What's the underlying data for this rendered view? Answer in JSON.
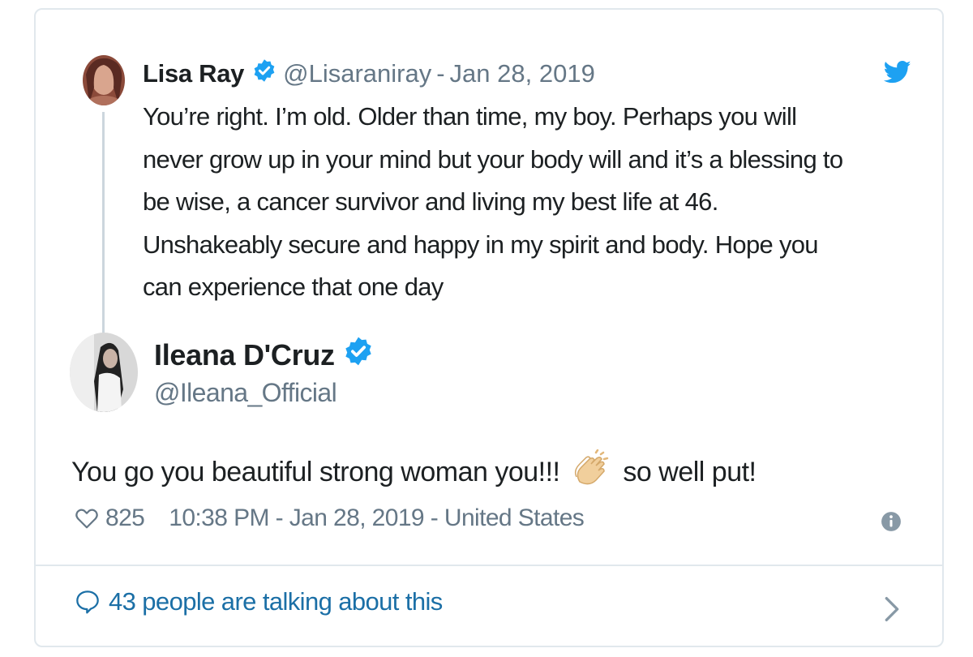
{
  "quoted_tweet": {
    "author_name": "Lisa Ray",
    "handle": "@Lisaraniray",
    "date": "Jan 28, 2019",
    "text_lines": [
      "You’re right. I’m old. Older than time, my boy. Perhaps you will",
      "never grow up in your mind but your body will and it’s a blessing to",
      "be wise, a cancer survivor and living my best life at 46.",
      "Unshakeably secure and happy in my spirit and body. Hope you",
      "can experience that one day"
    ]
  },
  "main_tweet": {
    "author_name": "Ileana D'Cruz",
    "handle": "@Ileana_Official",
    "text_before_emoji": "You go you beautiful strong woman you!!!",
    "emoji_name": "clapping-hands-icon",
    "text_after_emoji": "so well put!",
    "likes": "825",
    "timestamp": "10:38 PM - Jan 28, 2019 - United States"
  },
  "footer": {
    "conversation_text": "43 people are talking about this"
  },
  "colors": {
    "twitter_blue": "#1da1f2",
    "verified_blue": "#1da1f2",
    "link_blue": "#1b6fa6",
    "gray_text": "#657786",
    "border": "#e1e8ed"
  }
}
